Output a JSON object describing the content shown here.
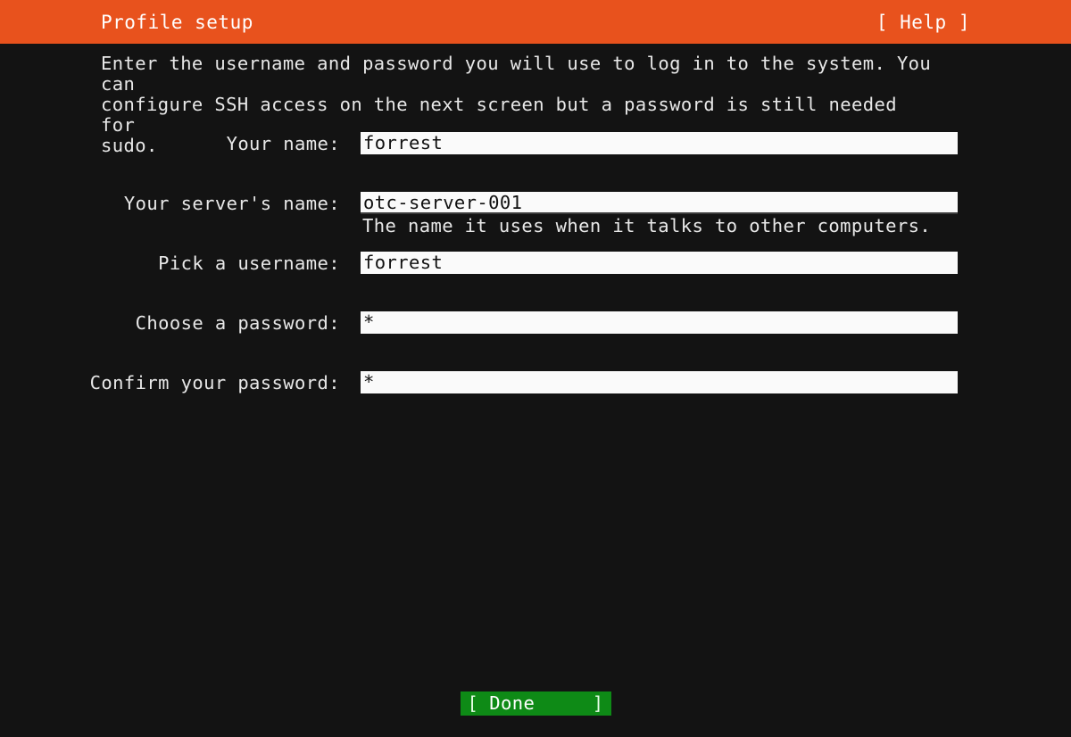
{
  "header": {
    "title": "Profile setup",
    "help_label": "[ Help ]",
    "background_color": "#e8521d",
    "text_color": "#ffffff"
  },
  "description": "Enter the username and password you will use to log in to the system. You can\nconfigure SSH access on the next screen but a password is still needed for\nsudo.",
  "form": {
    "fields": [
      {
        "label": "Your name:",
        "value": "forrest",
        "help": ""
      },
      {
        "label": "Your server's name:",
        "value": "otc-server-001",
        "help": "The name it uses when it talks to other computers."
      },
      {
        "label": "Pick a username:",
        "value": "forrest",
        "help": ""
      },
      {
        "label": "Choose a password:",
        "value": "*",
        "help": ""
      },
      {
        "label": "Confirm your password:",
        "value": "*",
        "help": ""
      }
    ]
  },
  "footer": {
    "done_bracket_left": "[",
    "done_label": "Done",
    "done_bracket_right": "]",
    "done_color": "#0e8a16"
  },
  "theme": {
    "background_color": "#131313",
    "foreground_color": "#e8e8e8",
    "input_background": "#fafafa",
    "input_foreground": "#101010"
  }
}
